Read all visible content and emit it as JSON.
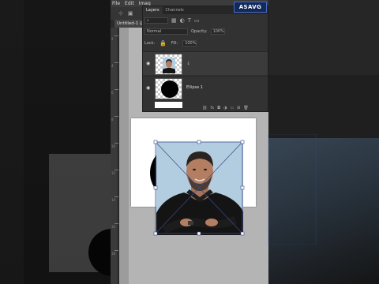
{
  "menu": [
    "File",
    "Edit",
    "Imag"
  ],
  "document": {
    "tab_title": "Untitled-1 @"
  },
  "layers_panel": {
    "tabs": [
      "Layers",
      "Channels"
    ],
    "blend_mode": "Normal",
    "opacity_label": "Opacity:",
    "opacity_value": "100%",
    "fill_label": "Fill:",
    "fill_value": "100%",
    "lock_label": "Lock:",
    "layers": [
      {
        "name": "",
        "type": "photo",
        "clipped": true
      },
      {
        "name": "Ellipse 1",
        "type": "shape"
      },
      {
        "name": "",
        "type": "background"
      }
    ]
  },
  "logo_text": "ASAVG",
  "ruler_numbers": [
    "2",
    "4",
    "6",
    "8",
    "10",
    "12",
    "14",
    "16",
    "18"
  ],
  "colors": {
    "photoshop_ui": "#2b2b2b",
    "canvas": "#b4b4b4",
    "selection_line": "#3b4a8a"
  }
}
